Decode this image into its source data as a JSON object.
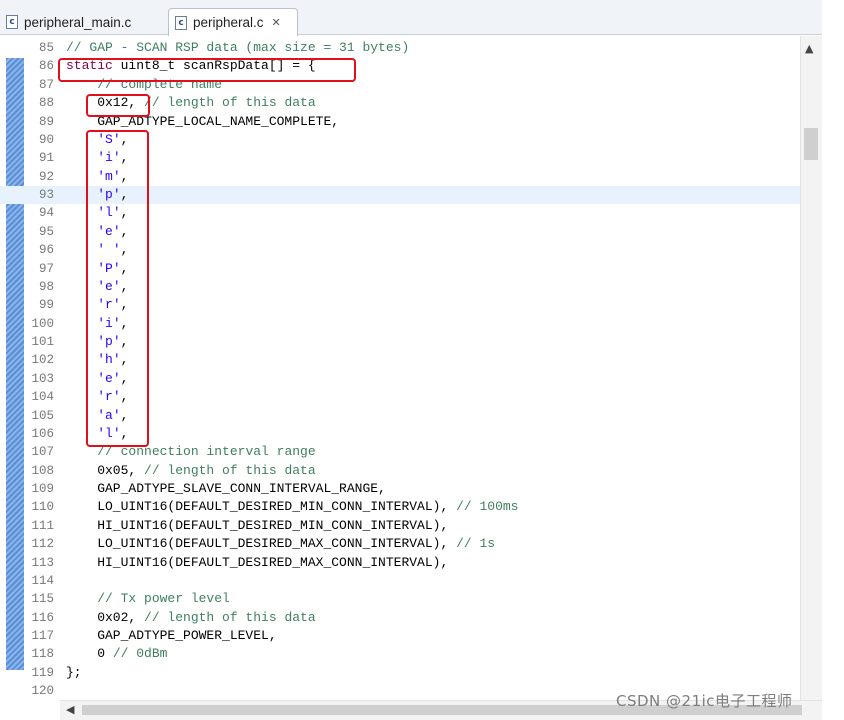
{
  "tabs": [
    {
      "label": "peripheral_main.c",
      "active": false
    },
    {
      "label": "peripheral.c",
      "active": true
    }
  ],
  "file_icon_letter": "c",
  "current_line": 93,
  "lines": [
    {
      "n": "85",
      "t": [
        [
          "c",
          "// GAP - SCAN RSP data (max size = 31 bytes)"
        ]
      ]
    },
    {
      "n": "86",
      "t": [
        [
          "k",
          "static "
        ],
        [
          "d",
          "uint8_t scanRspData[] = {"
        ]
      ]
    },
    {
      "n": "87",
      "t": [
        [
          "d",
          "    "
        ],
        [
          "c",
          "// complete name"
        ]
      ]
    },
    {
      "n": "88",
      "t": [
        [
          "d",
          "    0x12, "
        ],
        [
          "c",
          "// length of this data"
        ]
      ]
    },
    {
      "n": "89",
      "t": [
        [
          "d",
          "    GAP_ADTYPE_LOCAL_NAME_COMPLETE,"
        ]
      ]
    },
    {
      "n": "90",
      "t": [
        [
          "d",
          "    "
        ],
        [
          "s",
          "'S'"
        ],
        [
          "d",
          ","
        ]
      ]
    },
    {
      "n": "91",
      "t": [
        [
          "d",
          "    "
        ],
        [
          "s",
          "'i'"
        ],
        [
          "d",
          ","
        ]
      ]
    },
    {
      "n": "92",
      "t": [
        [
          "d",
          "    "
        ],
        [
          "s",
          "'m'"
        ],
        [
          "d",
          ","
        ]
      ]
    },
    {
      "n": "93",
      "t": [
        [
          "d",
          "    "
        ],
        [
          "s",
          "'p'"
        ],
        [
          "d",
          ","
        ]
      ]
    },
    {
      "n": "94",
      "t": [
        [
          "d",
          "    "
        ],
        [
          "s",
          "'l'"
        ],
        [
          "d",
          ","
        ]
      ]
    },
    {
      "n": "95",
      "t": [
        [
          "d",
          "    "
        ],
        [
          "s",
          "'e'"
        ],
        [
          "d",
          ","
        ]
      ]
    },
    {
      "n": "96",
      "t": [
        [
          "d",
          "    "
        ],
        [
          "s",
          "' '"
        ],
        [
          "d",
          ","
        ]
      ]
    },
    {
      "n": "97",
      "t": [
        [
          "d",
          "    "
        ],
        [
          "s",
          "'P'"
        ],
        [
          "d",
          ","
        ]
      ]
    },
    {
      "n": "98",
      "t": [
        [
          "d",
          "    "
        ],
        [
          "s",
          "'e'"
        ],
        [
          "d",
          ","
        ]
      ]
    },
    {
      "n": "99",
      "t": [
        [
          "d",
          "    "
        ],
        [
          "s",
          "'r'"
        ],
        [
          "d",
          ","
        ]
      ]
    },
    {
      "n": "100",
      "t": [
        [
          "d",
          "    "
        ],
        [
          "s",
          "'i'"
        ],
        [
          "d",
          ","
        ]
      ]
    },
    {
      "n": "101",
      "t": [
        [
          "d",
          "    "
        ],
        [
          "s",
          "'p'"
        ],
        [
          "d",
          ","
        ]
      ]
    },
    {
      "n": "102",
      "t": [
        [
          "d",
          "    "
        ],
        [
          "s",
          "'h'"
        ],
        [
          "d",
          ","
        ]
      ]
    },
    {
      "n": "103",
      "t": [
        [
          "d",
          "    "
        ],
        [
          "s",
          "'e'"
        ],
        [
          "d",
          ","
        ]
      ]
    },
    {
      "n": "104",
      "t": [
        [
          "d",
          "    "
        ],
        [
          "s",
          "'r'"
        ],
        [
          "d",
          ","
        ]
      ]
    },
    {
      "n": "105",
      "t": [
        [
          "d",
          "    "
        ],
        [
          "s",
          "'a'"
        ],
        [
          "d",
          ","
        ]
      ]
    },
    {
      "n": "106",
      "t": [
        [
          "d",
          "    "
        ],
        [
          "s",
          "'l'"
        ],
        [
          "d",
          ","
        ]
      ]
    },
    {
      "n": "107",
      "t": [
        [
          "d",
          "    "
        ],
        [
          "c",
          "// connection interval range"
        ]
      ]
    },
    {
      "n": "108",
      "t": [
        [
          "d",
          "    0x05, "
        ],
        [
          "c",
          "// length of this data"
        ]
      ]
    },
    {
      "n": "109",
      "t": [
        [
          "d",
          "    GAP_ADTYPE_SLAVE_CONN_INTERVAL_RANGE,"
        ]
      ]
    },
    {
      "n": "110",
      "t": [
        [
          "d",
          "    LO_UINT16(DEFAULT_DESIRED_MIN_CONN_INTERVAL), "
        ],
        [
          "c",
          "// 100ms"
        ]
      ]
    },
    {
      "n": "111",
      "t": [
        [
          "d",
          "    HI_UINT16(DEFAULT_DESIRED_MIN_CONN_INTERVAL),"
        ]
      ]
    },
    {
      "n": "112",
      "t": [
        [
          "d",
          "    LO_UINT16(DEFAULT_DESIRED_MAX_CONN_INTERVAL), "
        ],
        [
          "c",
          "// 1s"
        ]
      ]
    },
    {
      "n": "113",
      "t": [
        [
          "d",
          "    HI_UINT16(DEFAULT_DESIRED_MAX_CONN_INTERVAL),"
        ]
      ]
    },
    {
      "n": "114",
      "t": []
    },
    {
      "n": "115",
      "t": [
        [
          "d",
          "    "
        ],
        [
          "c",
          "// Tx power level"
        ]
      ]
    },
    {
      "n": "116",
      "t": [
        [
          "d",
          "    0x02, "
        ],
        [
          "c",
          "// length of this data"
        ]
      ]
    },
    {
      "n": "117",
      "t": [
        [
          "d",
          "    GAP_ADTYPE_POWER_LEVEL,"
        ]
      ]
    },
    {
      "n": "118",
      "t": [
        [
          "d",
          "    0 "
        ],
        [
          "c",
          "// 0dBm"
        ]
      ]
    },
    {
      "n": "119",
      "t": [
        [
          "d",
          "};"
        ]
      ]
    },
    {
      "n": "120",
      "t": []
    }
  ],
  "watermark": "CSDN @21ic电子工程师",
  "colors": {
    "highlight_box": "#e0101a",
    "comment": "#3f7f5f",
    "keyword": "#7f0055",
    "string": "#2a00ff",
    "current_line_bg": "#e8f2fe"
  },
  "icons": {
    "tab_file": "c-source-file-icon",
    "tab_close": "close-icon",
    "scroll_up": "arrow-up-icon",
    "scroll_left": "arrow-left-icon"
  }
}
